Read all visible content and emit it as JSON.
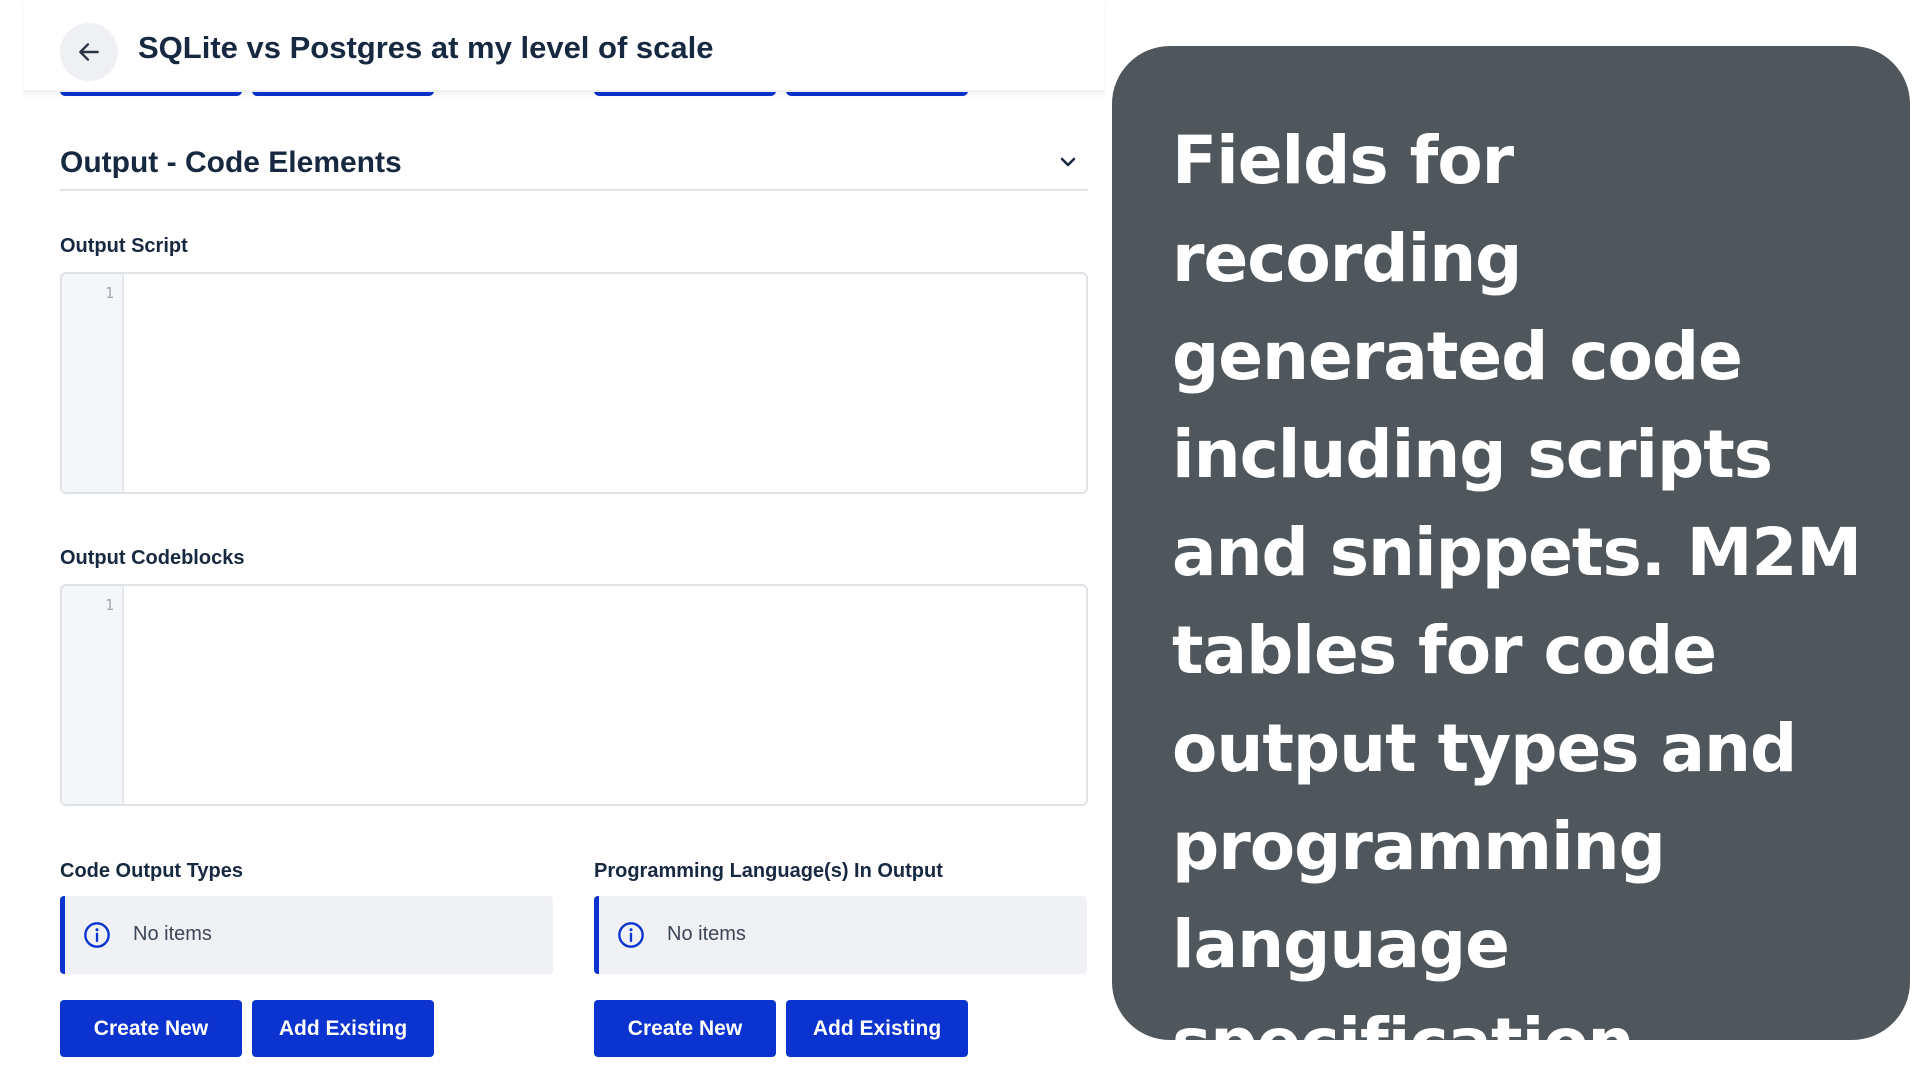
{
  "header": {
    "back_icon": "arrow-left-icon",
    "title": "SQLite vs Postgres at my level of scale"
  },
  "section": {
    "title": "Output - Code Elements",
    "chevron_icon": "chevron-down-icon"
  },
  "fields": {
    "output_script": {
      "label": "Output Script",
      "line_number": "1",
      "value": ""
    },
    "output_codeblocks": {
      "label": "Output Codeblocks",
      "line_number": "1",
      "value": ""
    },
    "code_output_types": {
      "label": "Code Output Types",
      "notice_icon": "info-icon",
      "notice_text": "No items",
      "create_label": "Create New",
      "add_label": "Add Existing"
    },
    "programming_languages": {
      "label": "Programming Language(s) In Output",
      "notice_icon": "info-icon",
      "notice_text": "No items",
      "create_label": "Create New",
      "add_label": "Add Existing"
    }
  },
  "caption": {
    "text": "Fields for recording generated code including scripts and snippets. M2M tables for code output types and programming language specification"
  },
  "colors": {
    "primary": "#0a33d0",
    "heading": "#172940",
    "caption_bg": "#50575c",
    "notice_bg": "#eff1f4"
  }
}
